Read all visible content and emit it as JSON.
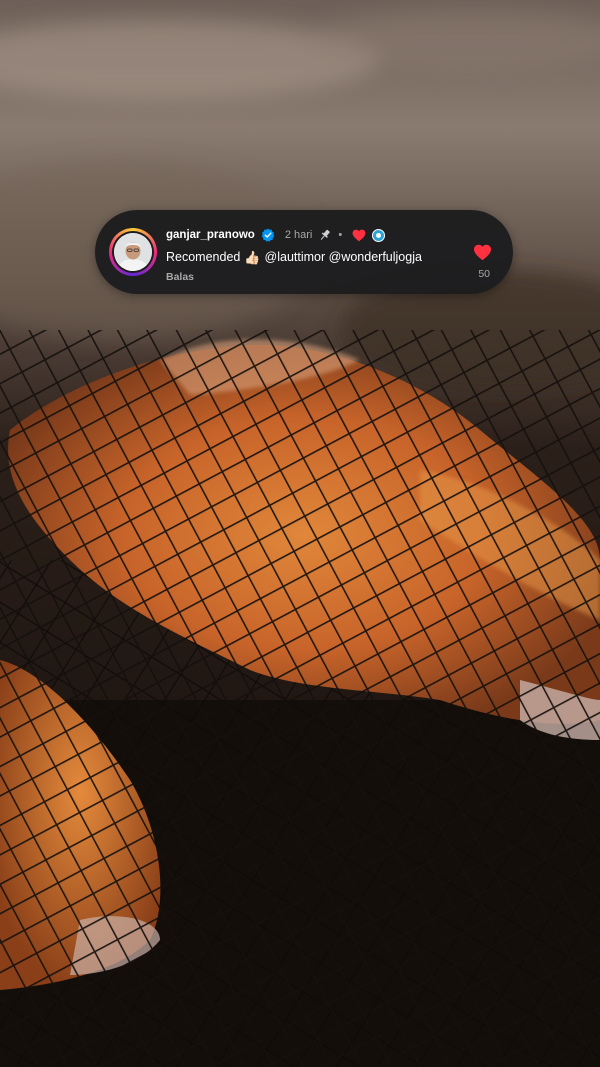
{
  "comment": {
    "username": "ganjar_pranowo",
    "time": "2 hari",
    "separator": "•",
    "text_prefix": "Recomended",
    "text_mentions": "@lauttimor @wonderfuljogja",
    "reply_label": "Balas",
    "like_count": "50",
    "verified": true,
    "pinned": true,
    "liked_by_creator": true
  },
  "icons": {
    "verified": "verified-badge-icon",
    "pin": "pin-icon",
    "creator_heart": "heart-icon",
    "creator_badge": "creator-avatar-icon",
    "thumbs_up": "thumbs-up-emoji",
    "like": "heart-icon"
  },
  "colors": {
    "bubble_bg": "#1c1c1e",
    "like_red": "#ff3040",
    "verified_blue": "#0095f6",
    "secondary_text": "#a8a8a8"
  }
}
